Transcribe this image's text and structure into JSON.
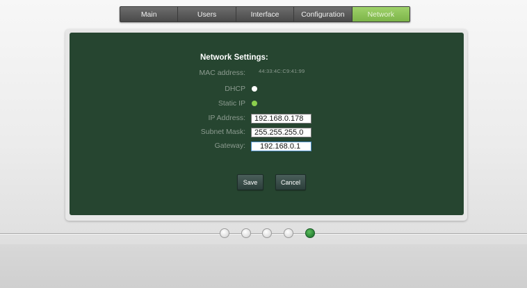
{
  "nav": {
    "tabs": [
      {
        "label": "Main",
        "active": false
      },
      {
        "label": "Users",
        "active": false
      },
      {
        "label": "Interface",
        "active": false
      },
      {
        "label": "Configuration",
        "active": false
      },
      {
        "label": "Network",
        "active": true
      }
    ]
  },
  "panel": {
    "title": "Network  Settings:",
    "mac_label": "MAC address:",
    "mac_value": "44:33:4C:C9:41:99",
    "dhcp_label": "DHCP",
    "dhcp_selected": false,
    "static_label": "Static IP",
    "static_selected": true,
    "ip_label": "IP Address:",
    "ip_value": "192.168.0.178",
    "subnet_label": "Subnet Mask:",
    "subnet_value": "255.255.255.0",
    "gateway_label": "Gateway:",
    "gateway_value": "192.168.0.1",
    "save_label": "Save",
    "cancel_label": "Cancel"
  },
  "progress": {
    "total_steps": 5,
    "current_step": 5
  },
  "colors": {
    "panel_bg": "#264530",
    "active_tab": "#8cc358",
    "radio_on": "#8ccf4d",
    "active_dot": "#2f8a3a"
  }
}
